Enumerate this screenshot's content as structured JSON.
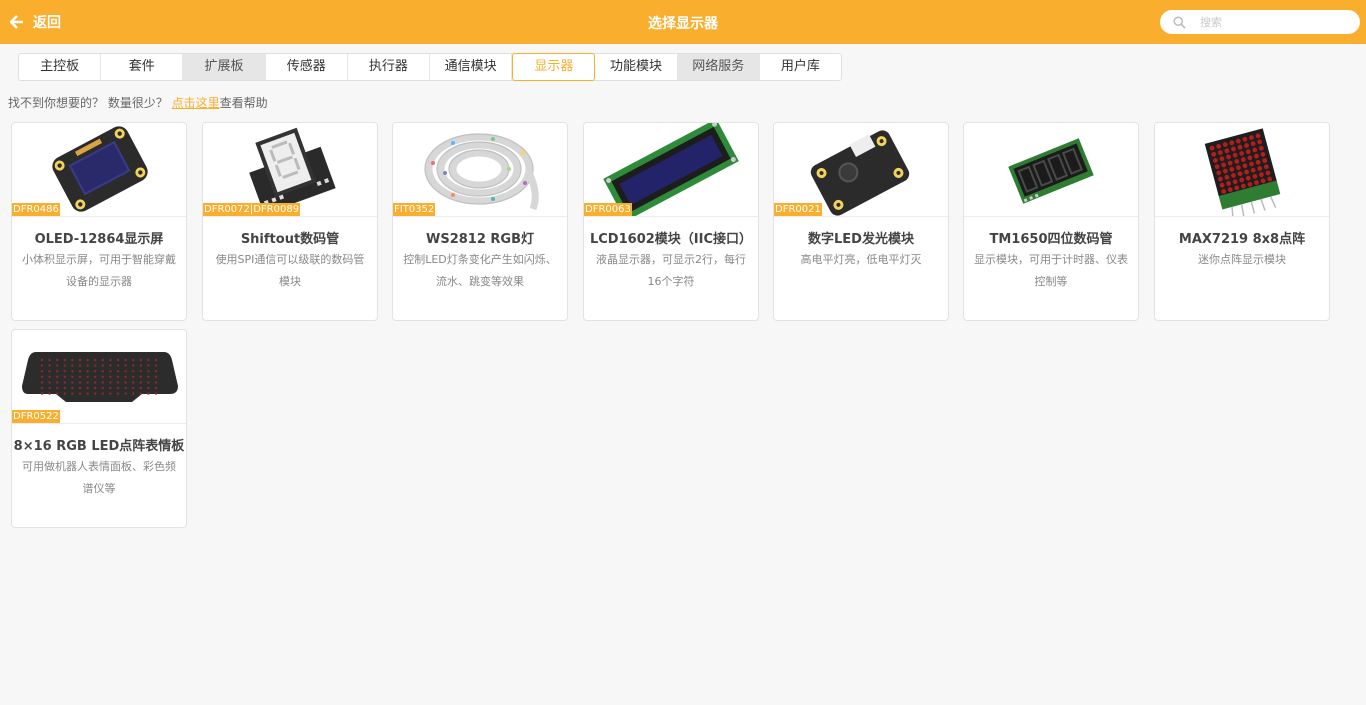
{
  "header": {
    "back_label": "返回",
    "title": "选择显示器",
    "search_placeholder": "搜索"
  },
  "tabs": [
    {
      "label": "主控板",
      "state": "normal"
    },
    {
      "label": "套件",
      "state": "normal"
    },
    {
      "label": "扩展板",
      "state": "gray"
    },
    {
      "label": "传感器",
      "state": "normal"
    },
    {
      "label": "执行器",
      "state": "normal"
    },
    {
      "label": "通信模块",
      "state": "normal"
    },
    {
      "label": "显示器",
      "state": "active"
    },
    {
      "label": "功能模块",
      "state": "normal"
    },
    {
      "label": "网络服务",
      "state": "gray"
    },
    {
      "label": "用户库",
      "state": "normal"
    }
  ],
  "help": {
    "prefix": "找不到你想要的？ 数量很少？",
    "link": "点击这里",
    "suffix": "查看帮助"
  },
  "cards": [
    {
      "sku": "DFR0486",
      "name": "OLED-12864显示屏",
      "desc": "小体积显示屏，可用于智能穿戴设备的显示器",
      "icon": "oled-display-icon"
    },
    {
      "sku": "DFR0072|DFR0089",
      "name": "Shiftout数码管",
      "desc": "使用SPI通信可以级联的数码管模块",
      "icon": "seven-segment-icon"
    },
    {
      "sku": "FIT0352",
      "name": "WS2812 RGB灯",
      "desc": "控制LED灯条变化产生如闪烁、流水、跳变等效果",
      "icon": "led-strip-icon"
    },
    {
      "sku": "DFR0063",
      "name": "LCD1602模块（IIC接口）",
      "desc": "液晶显示器，可显示2行，每行16个字符",
      "icon": "lcd1602-icon"
    },
    {
      "sku": "DFR0021",
      "name": "数字LED发光模块",
      "desc": "高电平灯亮，低电平灯灭",
      "icon": "led-module-icon"
    },
    {
      "sku": "",
      "name": "TM1650四位数码管",
      "desc": "显示模块，可用于计时器、仪表控制等",
      "icon": "four-digit-display-icon"
    },
    {
      "sku": "",
      "name": "MAX7219 8x8点阵",
      "desc": "迷你点阵显示模块",
      "icon": "dot-matrix-icon"
    },
    {
      "sku": "DFR0522",
      "name": "8×16 RGB LED点阵表情板",
      "desc": "可用做机器人表情面板、彩色频谱仪等",
      "icon": "led-matrix-panel-icon"
    }
  ],
  "colors": {
    "accent": "#f9ae2e"
  }
}
